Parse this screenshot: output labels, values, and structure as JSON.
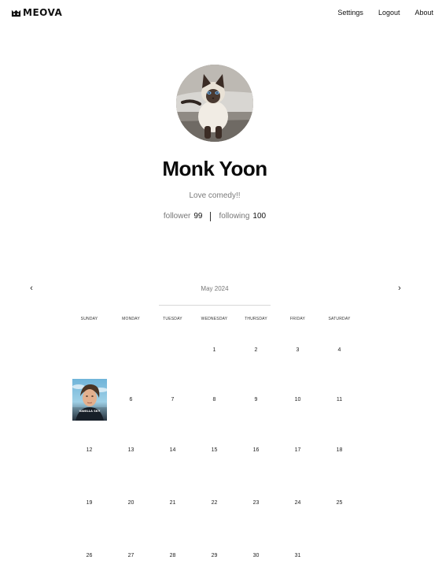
{
  "brand": {
    "logo_text": "MEOVA",
    "logo_icon": "cat-face-icon"
  },
  "nav": {
    "settings_label": "Settings",
    "logout_label": "Logout",
    "about_label": "About"
  },
  "profile": {
    "avatar_icon": "siamese-cat-photo",
    "name": "Monk Yoon",
    "bio": "Love comedy!!",
    "follower_label": "follower",
    "follower_count": "99",
    "following_label": "following",
    "following_count": "100"
  },
  "calendar": {
    "prev_icon": "chevron-left-icon",
    "next_icon": "chevron-right-icon",
    "prev_glyph": "‹",
    "next_glyph": "›",
    "month_label": "May 2024",
    "weekdays": [
      "SUNDAY",
      "MONDAY",
      "TUESDAY",
      "WEDNESDAY",
      "THURSDAY",
      "FRIDAY",
      "SATURDAY"
    ],
    "weeks": [
      [
        "",
        "",
        "",
        "1",
        "2",
        "3",
        "4"
      ],
      [
        "5",
        "6",
        "7",
        "8",
        "9",
        "10",
        "11"
      ],
      [
        "12",
        "13",
        "14",
        "15",
        "16",
        "17",
        "18"
      ],
      [
        "19",
        "20",
        "21",
        "22",
        "23",
        "24",
        "25"
      ],
      [
        "26",
        "27",
        "28",
        "29",
        "30",
        "31",
        ""
      ]
    ],
    "posters": [
      {
        "day": "5",
        "title": "VANILLA SKY"
      }
    ]
  },
  "colors": {
    "text": "#111111",
    "muted": "#777777",
    "divider": "#d8d8d8",
    "background": "#ffffff"
  }
}
